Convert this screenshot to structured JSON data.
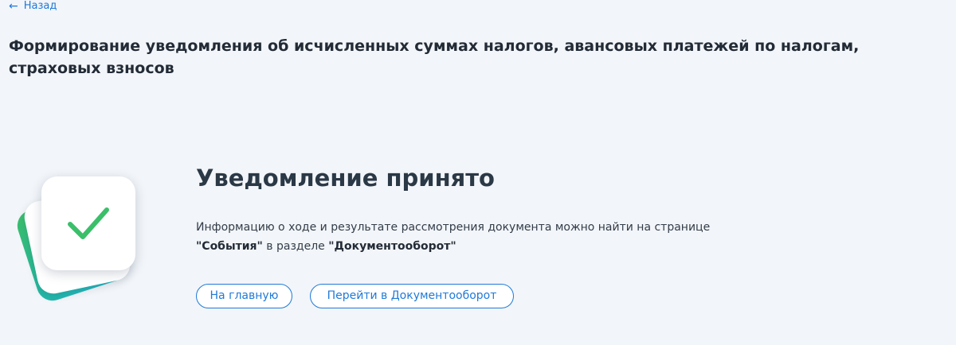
{
  "nav": {
    "back_arrow": "←",
    "back_label": "Назад"
  },
  "page": {
    "title": "Формирование уведомления об исчисленных суммах налогов, авансовых платежей по налогам, страховых взносов"
  },
  "result": {
    "icon": "success-check-icon",
    "status_title": "Уведомление принято",
    "info_text_1": "Информацию о ходе и результате рассмотрения документа можно найти на странице",
    "info_link_events": "\"События\"",
    "info_text_2": " в разделе ",
    "info_link_docflow": "\"Документооборот\""
  },
  "actions": {
    "home_label": "На главную",
    "docflow_label": "Перейти в Документооборот"
  },
  "colors": {
    "accent": "#1f7ad8",
    "background": "#f2f5f9",
    "success": "#3bbf6a"
  }
}
